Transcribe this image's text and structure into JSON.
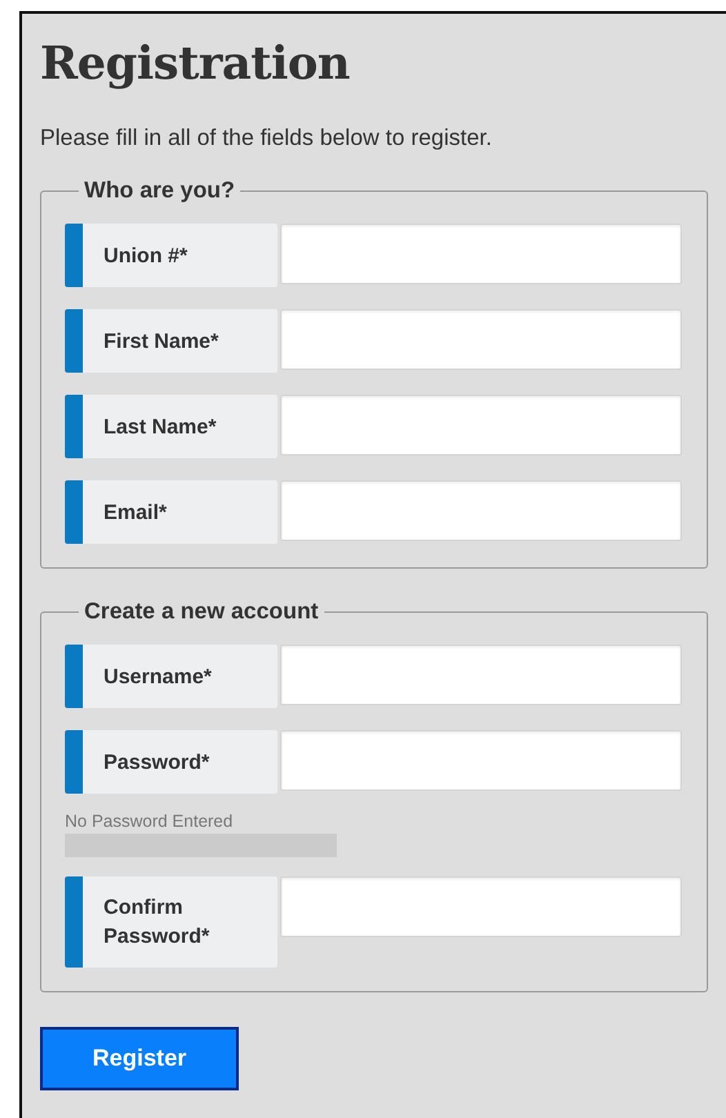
{
  "title": "Registration",
  "intro": "Please fill in all of the fields below to register.",
  "sections": [
    {
      "legend": "Who are you?",
      "fields": [
        {
          "label": "Union #*",
          "kind": "text"
        },
        {
          "label": "First Name*",
          "kind": "text"
        },
        {
          "label": "Last Name*",
          "kind": "text"
        },
        {
          "label": "Email*",
          "kind": "text"
        }
      ]
    },
    {
      "legend": "Create a new account",
      "fields": [
        {
          "label": "Username*",
          "kind": "text"
        },
        {
          "label": "Password*",
          "kind": "password"
        },
        {
          "kind": "strength",
          "text": "No Password Entered",
          "level": 0
        },
        {
          "label": "Confirm Password*",
          "kind": "password"
        }
      ]
    }
  ],
  "button": "Register"
}
